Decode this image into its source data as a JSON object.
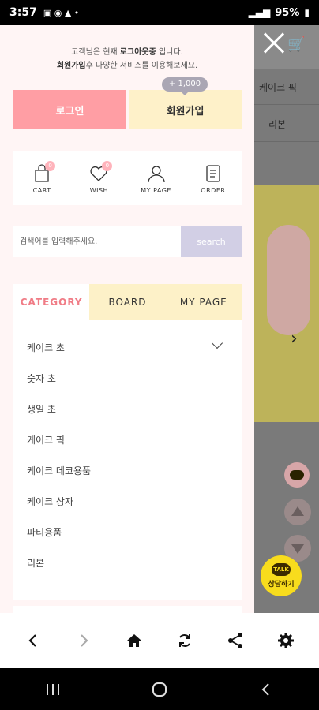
{
  "status_bar": {
    "time": "3:57",
    "battery": "95%"
  },
  "background_page": {
    "menu_item_1": "케이크 픽",
    "menu_item_2": "리본"
  },
  "drawer": {
    "welcome_line1_pre": "고객님은 현재 ",
    "welcome_line1_bold": "로그아웃중",
    "welcome_line1_post": " 입니다.",
    "welcome_line2_bold": "회원가입",
    "welcome_line2_post": "후 다양한 서비스를 이용해보세요.",
    "login_label": "로그인",
    "join_label": "회원가입",
    "join_badge": "+ 1,000",
    "quick_links": [
      {
        "label": "CART",
        "count": "0",
        "icon": "bag-icon"
      },
      {
        "label": "WISH",
        "count": "0",
        "icon": "heart-icon"
      },
      {
        "label": "MY PAGE",
        "icon": "user-icon"
      },
      {
        "label": "ORDER",
        "icon": "receipt-icon"
      }
    ],
    "search": {
      "placeholder": "검색어를 입력해주세요.",
      "button": "search"
    },
    "tabs": [
      "CATEGORY",
      "BOARD",
      "MY PAGE"
    ],
    "categories": [
      "케이크 초",
      "숫자 초",
      "생일 초",
      "케이크 픽",
      "케이크 데코용품",
      "케이크 상자",
      "파티용품",
      "리본"
    ],
    "kakao_label": "상담하기"
  },
  "colors": {
    "login": "#ff9ea4",
    "join": "#fef1c9",
    "tab_active_text": "#f07c86",
    "search_button": "#d2cfe5"
  }
}
